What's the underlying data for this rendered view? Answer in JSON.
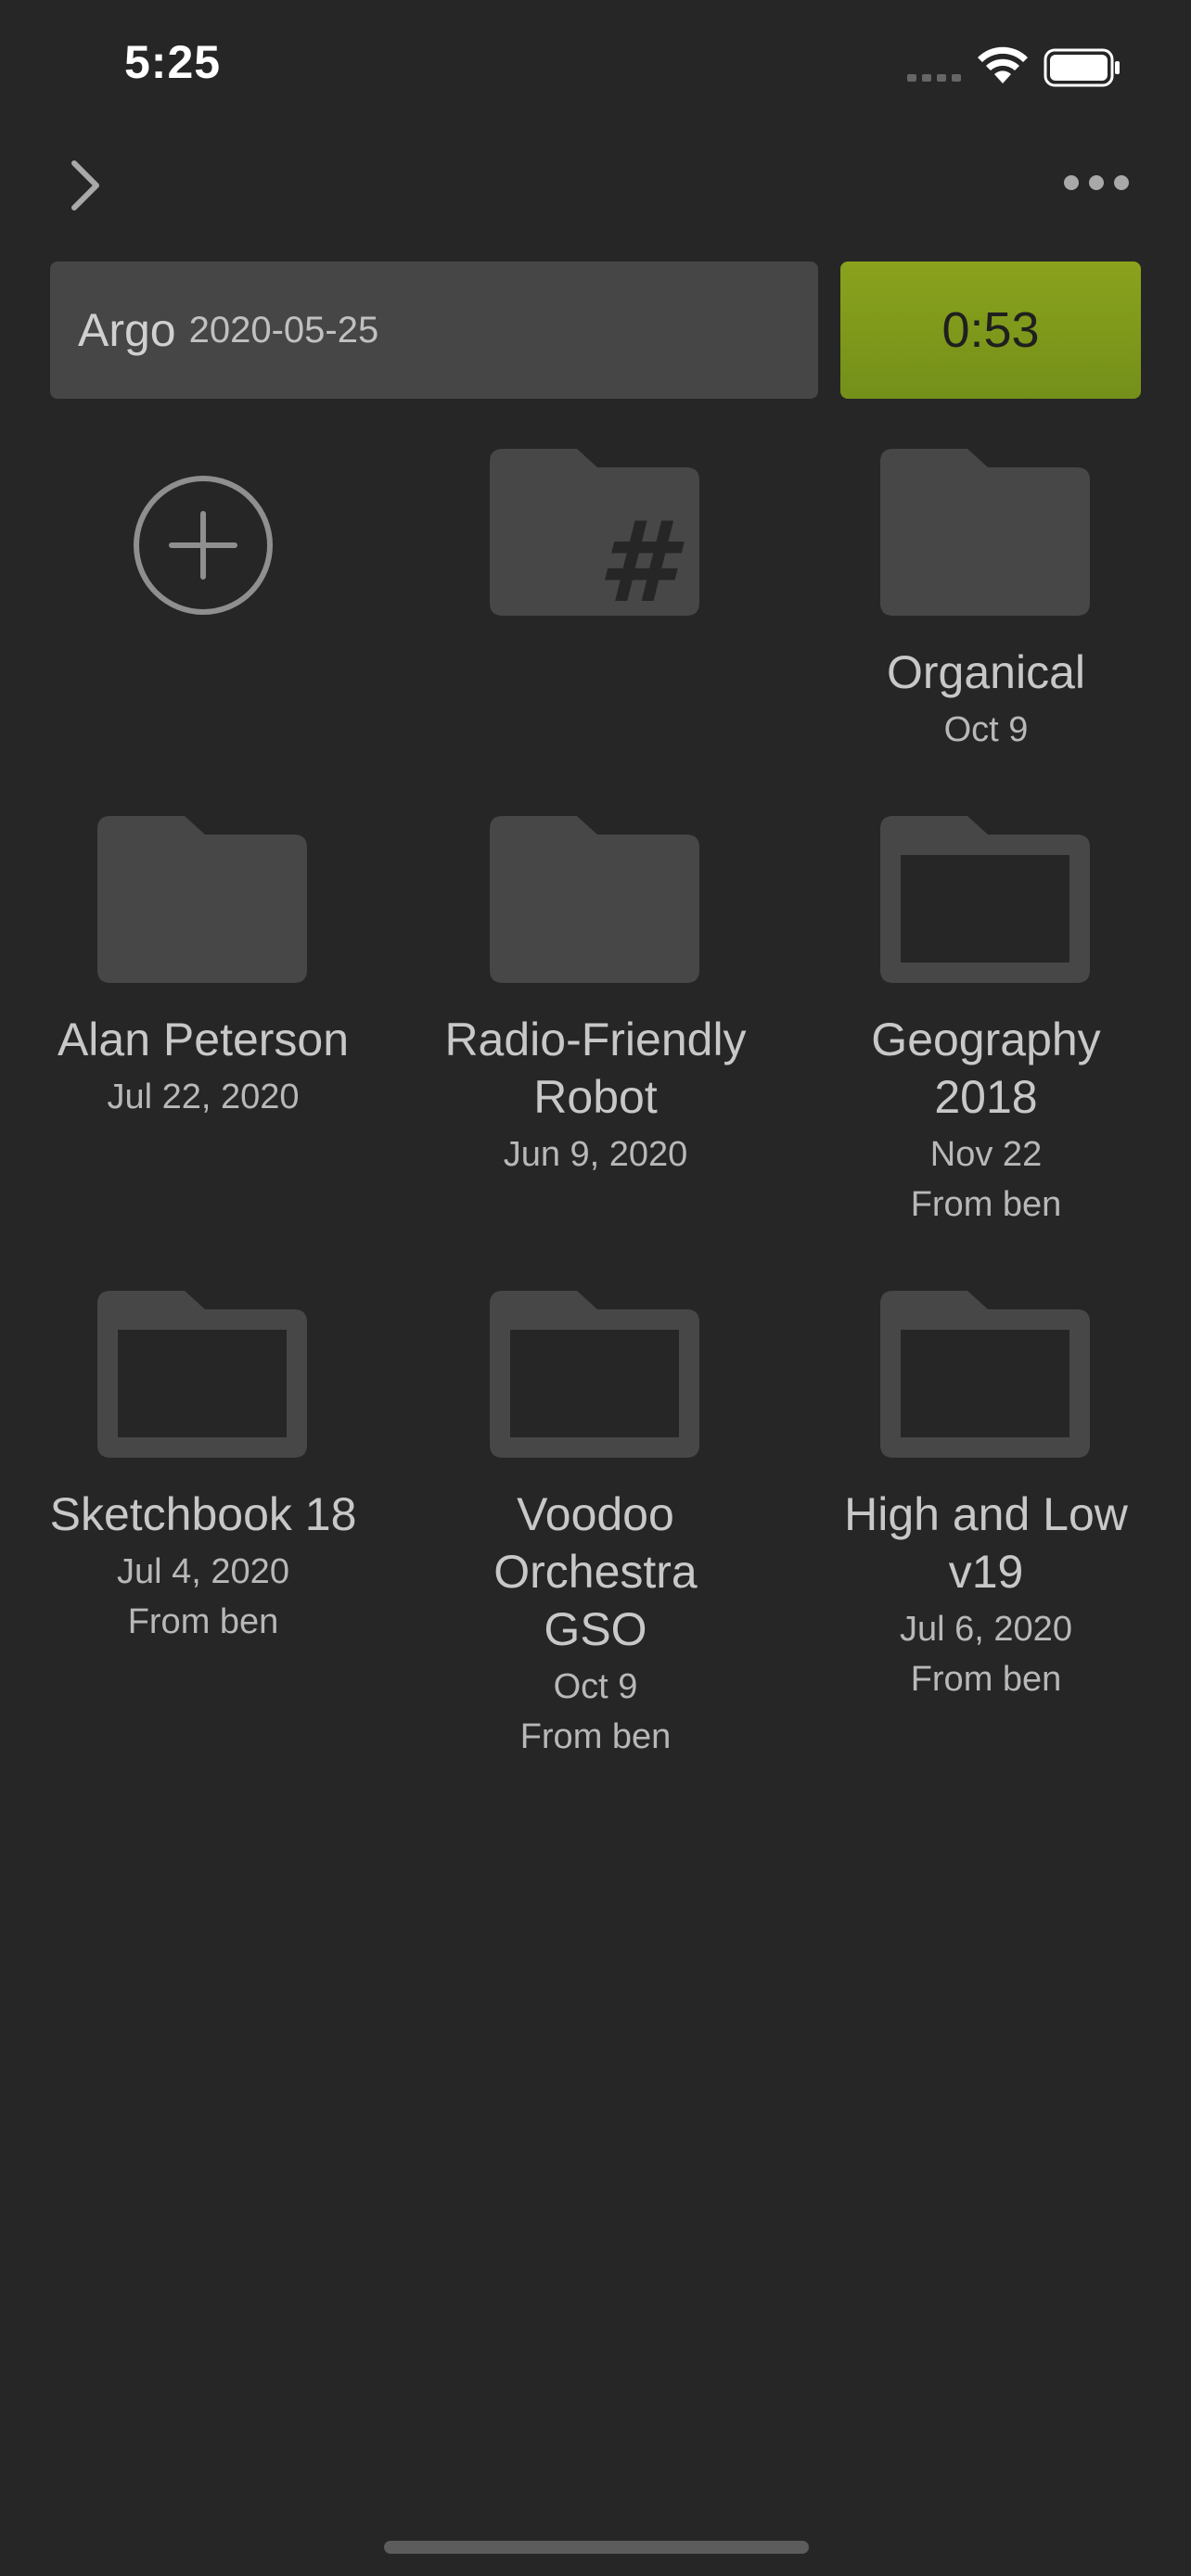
{
  "status": {
    "time": "5:25"
  },
  "header": {
    "title_name": "Argo",
    "title_date": "2020-05-25",
    "timer": "0:53"
  },
  "grid": {
    "items": [
      {
        "name": "Organical",
        "date": "Oct 9",
        "from": ""
      },
      {
        "name": "Alan Peterson",
        "date": "Jul 22, 2020",
        "from": ""
      },
      {
        "name": "Radio-Friendly Robot",
        "date": "Jun 9, 2020",
        "from": ""
      },
      {
        "name": "Geography 2018",
        "date": "Nov 22",
        "from": "From ben"
      },
      {
        "name": "Sketchbook 18",
        "date": "Jul 4, 2020",
        "from": "From ben"
      },
      {
        "name": "Voodoo Orchestra GSO",
        "date": "Oct 9",
        "from": "From ben"
      },
      {
        "name": "High and Low v19",
        "date": "Jul 6, 2020",
        "from": "From ben"
      }
    ]
  },
  "colors": {
    "background": "#262626",
    "folder_fill": "#474747",
    "timer_accent": "#86a01c"
  },
  "icons": {
    "add": "plus-circle-icon",
    "tag_folder": "hashtag-folder-icon",
    "more": "more-dots-icon",
    "nav": "chevron-right-icon"
  }
}
